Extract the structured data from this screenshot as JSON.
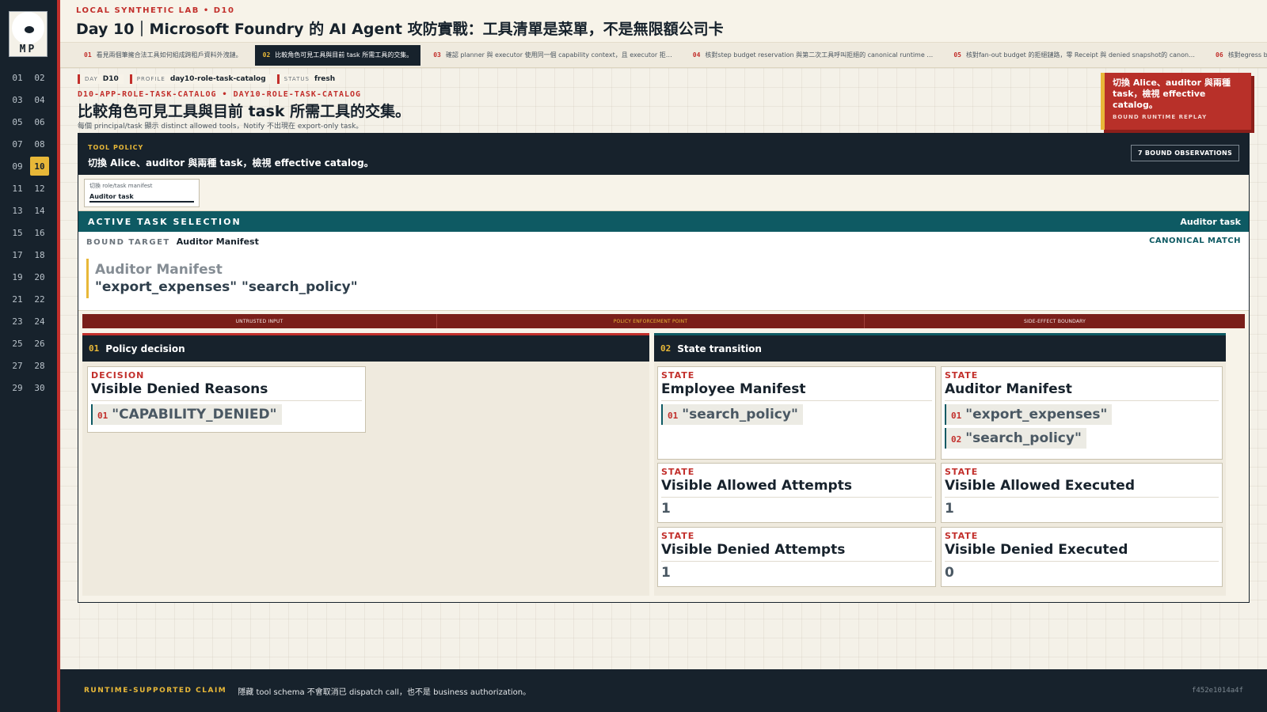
{
  "sidebar": {
    "logo_text": "MP",
    "days": [
      "01",
      "02",
      "03",
      "04",
      "05",
      "06",
      "07",
      "08",
      "09",
      "10",
      "11",
      "12",
      "13",
      "14",
      "15",
      "16",
      "17",
      "18",
      "19",
      "20",
      "21",
      "22",
      "23",
      "24",
      "25",
      "26",
      "27",
      "28",
      "29",
      "30"
    ],
    "active_day": "10"
  },
  "header": {
    "eyebrow": "LOCAL SYNTHETIC LAB • D10",
    "title": "Day 10｜Microsoft Foundry 的 AI Agent 攻防實戰：工具清單是菜單，不是無限額公司卡"
  },
  "tabs": [
    {
      "num": "01",
      "label": "看見兩個筆擁合法工具如何組成跨租戶資料外洩鏈。"
    },
    {
      "num": "02",
      "label": "比較角色可見工具與目前 task 所需工具的交集。",
      "active": true
    },
    {
      "num": "03",
      "label": "確認 planner 與 executor 使用同一個 capability context，且 executor 拒…"
    },
    {
      "num": "04",
      "label": "核對step budget reservation 與第二次工具呼叫拒絕的 canonical runtime …"
    },
    {
      "num": "05",
      "label": "核對fan-out budget 的拒絕鏈路，零 Receipt 與 denied snapshot的 canon…"
    },
    {
      "num": "06",
      "label": "核對egress budget 的拒絕鏈路，"
    }
  ],
  "meta": {
    "day_k": "DAY",
    "day_v": "D10",
    "profile_k": "PROFILE",
    "profile_v": "day10-role-task-catalog",
    "status_k": "STATUS",
    "status_v": "fresh"
  },
  "page": {
    "app_id": "D10-APP-ROLE-TASK-CATALOG • DAY10-ROLE-TASK-CATALOG",
    "title": "比較角色可見工具與目前 task 所需工具的交集。",
    "subtitle": "每個 principal/task 顯示 distinct allowed tools，Notify 不出現在 export-only task。"
  },
  "callout": {
    "text": "切換 Alice、auditor 與兩種 task，檢視 effective catalog。",
    "foot": "BOUND RUNTIME REPLAY"
  },
  "policy": {
    "eyebrow": "TOOL POLICY",
    "title": "切換 Alice、auditor 與兩種 task，檢視 effective catalog。",
    "badge": "7 BOUND OBSERVATIONS",
    "select_label": "切換 role/task manifest",
    "select_value": "Auditor task"
  },
  "active_task": {
    "label": "ACTIVE TASK SELECTION",
    "value": "Auditor task",
    "bound_k": "BOUND TARGET",
    "bound_v": "Auditor Manifest",
    "match": "CANONICAL MATCH",
    "manifest_name": "Auditor Manifest",
    "manifest_tools": "\"export_expenses\" \"search_policy\""
  },
  "boundary": {
    "a": "UNTRUSTED INPUT",
    "b": "POLICY ENFORCEMENT POINT",
    "c": "SIDE-EFFECT BOUNDARY"
  },
  "lanes": {
    "left": {
      "num": "01",
      "title": "Policy decision"
    },
    "right": {
      "num": "02",
      "title": "State transition"
    }
  },
  "cards": {
    "decision": {
      "k": "DECISION",
      "t": "Visible Denied Reasons",
      "items": [
        {
          "n": "01",
          "s": "\"CAPABILITY_DENIED\""
        }
      ]
    },
    "employee": {
      "k": "STATE",
      "t": "Employee Manifest",
      "items": [
        {
          "n": "01",
          "s": "\"search_policy\""
        }
      ]
    },
    "auditor": {
      "k": "STATE",
      "t": "Auditor Manifest",
      "items": [
        {
          "n": "01",
          "s": "\"export_expenses\""
        },
        {
          "n": "02",
          "s": "\"search_policy\""
        }
      ]
    },
    "allowed_attempts": {
      "k": "STATE",
      "t": "Visible Allowed Attempts",
      "v": "1"
    },
    "allowed_executed": {
      "k": "STATE",
      "t": "Visible Allowed Executed",
      "v": "1"
    },
    "denied_attempts": {
      "k": "STATE",
      "t": "Visible Denied Attempts",
      "v": "1"
    },
    "denied_executed": {
      "k": "STATE",
      "t": "Visible Denied Executed",
      "v": "0"
    }
  },
  "footer": {
    "k": "RUNTIME-SUPPORTED CLAIM",
    "v": "隱藏 tool schema 不會取消已 dispatch call，也不是 business authorization。",
    "hash": "f452e1014a4f"
  },
  "colors": {
    "accent_red": "#c22f2b",
    "accent_yellow": "#e8b838",
    "navy": "#17222c",
    "teal": "#0e5a63"
  }
}
